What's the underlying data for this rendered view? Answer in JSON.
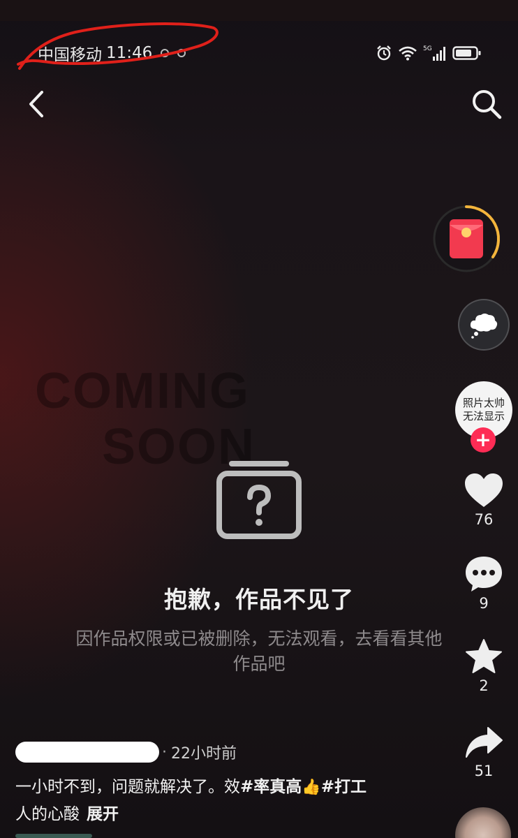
{
  "status_bar": {
    "carrier": "中国移动",
    "time": "11:46",
    "network": "5G"
  },
  "nav": {
    "back_icon": "chevron-left-icon",
    "search_icon": "search-icon"
  },
  "background_text": {
    "line1": "COMING",
    "line2": "SOON"
  },
  "notice": {
    "icon": "missing-content-icon",
    "title": "抱歉，作品不见了",
    "description_line1": "因作品权限或已被删除，无法观看，去看看其他",
    "description_line2": "作品吧"
  },
  "sidebar": {
    "avatar_text_line1": "照片太帅",
    "avatar_text_line2": "无法显示",
    "follow_label": "+",
    "likes": "76",
    "comments": "9",
    "favorites": "2",
    "shares": "51"
  },
  "post": {
    "time_ago": "22小时前",
    "caption_text": "一小时不到，问题就解决了。效",
    "hashtag1": "#率真高",
    "emoji": "👍",
    "hashtag2": "#打工",
    "caption_line2": "人的心酸",
    "expand_label": "展开"
  },
  "colors": {
    "accent": "#fe2c55",
    "annotation": "#e0201a"
  }
}
